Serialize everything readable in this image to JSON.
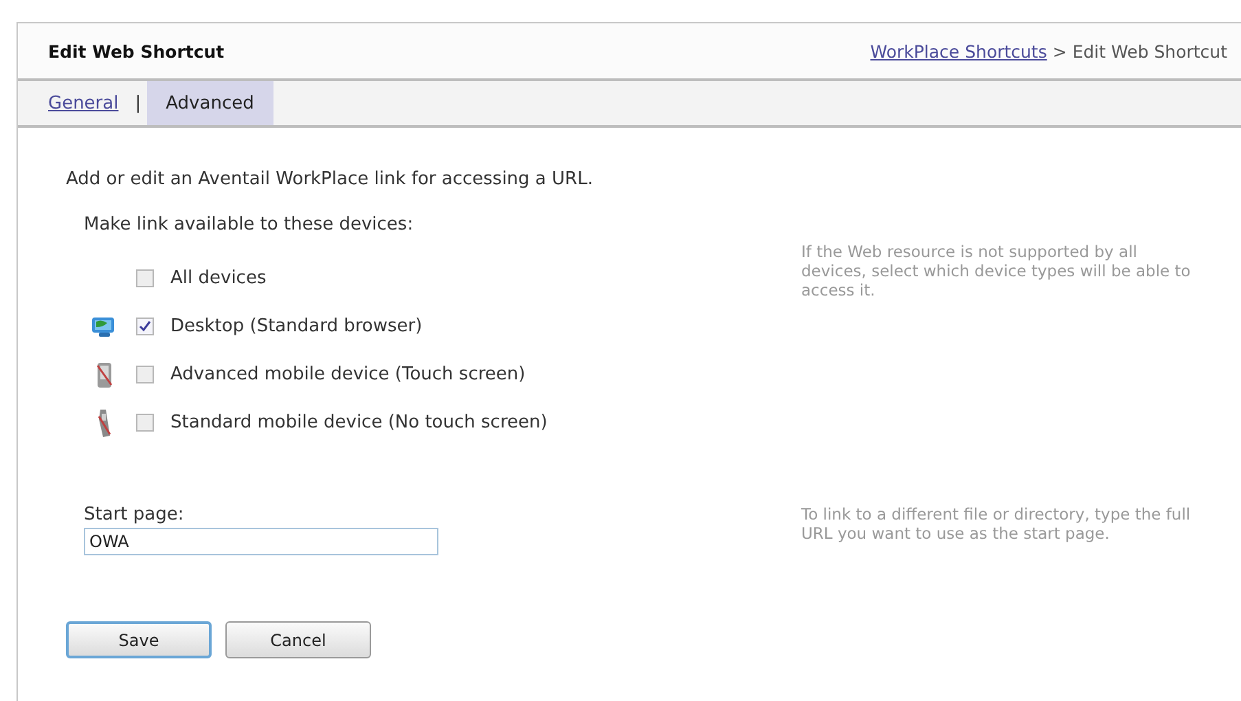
{
  "header": {
    "title": "Edit Web Shortcut",
    "breadcrumb": {
      "link": "WorkPlace Shortcuts",
      "separator": ">",
      "current": "Edit Web Shortcut"
    }
  },
  "tabs": [
    {
      "label": "General",
      "selected": false
    },
    {
      "label": "Advanced",
      "selected": true
    }
  ],
  "tab_separator": "|",
  "intro": "Add or edit an Aventail WorkPlace link for accessing a URL.",
  "devices": {
    "heading": "Make link available to these devices:",
    "help": "If the Web resource is not supported by all devices, select which device types will be able to access it.",
    "items": [
      {
        "kind": "none",
        "label": "All devices",
        "checked": false
      },
      {
        "kind": "desktop",
        "label": "Desktop (Standard browser)",
        "checked": true
      },
      {
        "kind": "touch",
        "label": "Advanced mobile device (Touch screen)",
        "checked": false
      },
      {
        "kind": "phone",
        "label": "Standard mobile device (No touch screen)",
        "checked": false
      }
    ]
  },
  "start_page": {
    "label": "Start page:",
    "value": "OWA",
    "help": "To link to a different file or directory, type the full URL you want to use as the start page."
  },
  "buttons": [
    {
      "label": "Save",
      "focused": true
    },
    {
      "label": "Cancel",
      "focused": false
    }
  ]
}
